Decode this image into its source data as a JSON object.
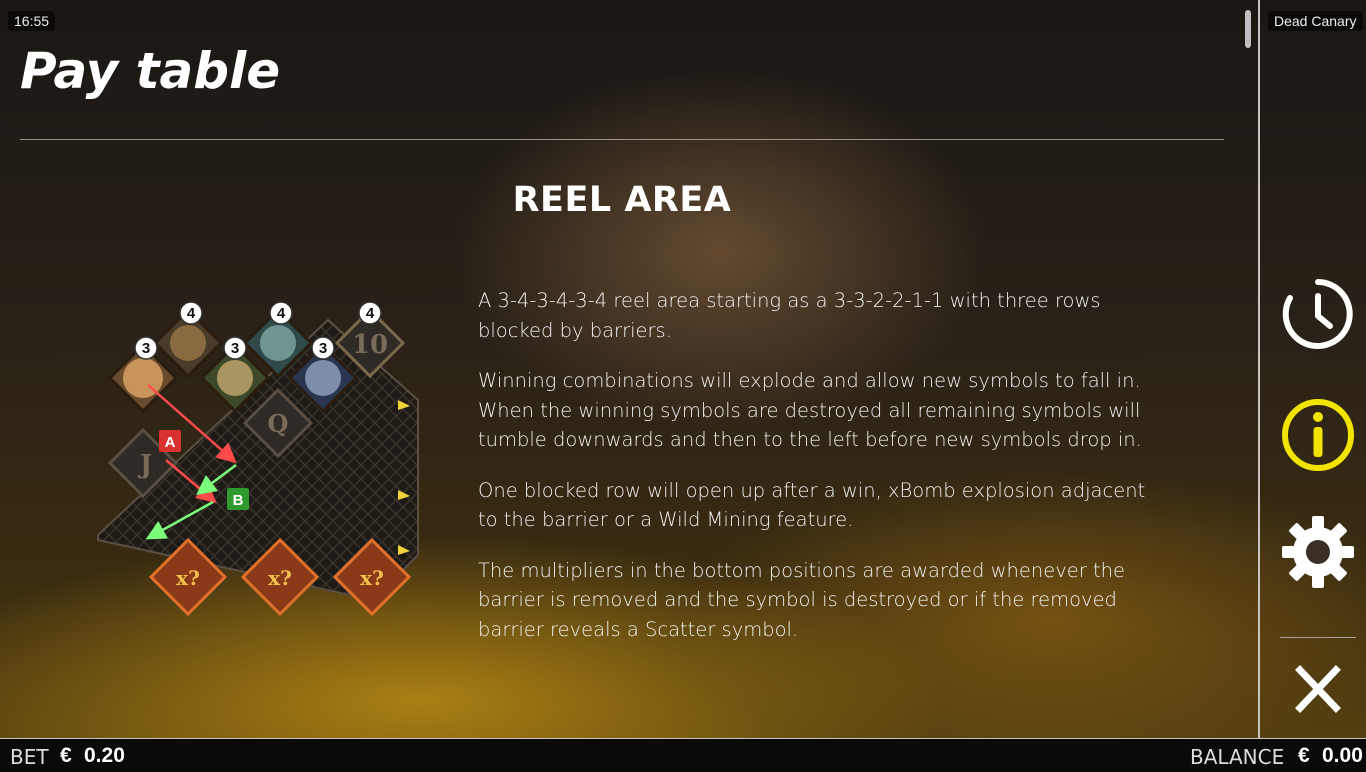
{
  "status": {
    "time": "16:55",
    "game_name": "Dead Canary"
  },
  "header": {
    "title": "Pay table"
  },
  "section": {
    "title": "REEL AREA",
    "paragraphs": [
      "A 3-4-3-4-3-4 reel area starting as a 3-3-2-2-1-1 with three rows blocked by barriers.",
      "Winning combinations will explode and allow new symbols to fall in. When the winning symbols are destroyed all remaining symbols will tumble downwards and then to the left before new symbols drop in.",
      "One blocked row will open up after a win, xBomb explosion adjacent to the barrier or a Wild Mining feature.",
      "The multipliers in the bottom positions are awarded whenever the barrier is removed and the symbol is destroyed or if the removed barrier reveals a Scatter symbol."
    ]
  },
  "diagram": {
    "reel_counts": [
      "3",
      "4",
      "3",
      "4",
      "3",
      "4"
    ],
    "symbols": [
      "10",
      "Q",
      "J"
    ],
    "marker_a": "A",
    "marker_b": "B",
    "multiplier_label": "x?"
  },
  "sidebar": {
    "history_icon": "clock-history-icon",
    "info_icon": "info-icon",
    "settings_icon": "gear-icon",
    "close_icon": "close-icon"
  },
  "footer": {
    "bet_label": "BET",
    "bet_currency": "€",
    "bet_value": "0.20",
    "balance_label": "BALANCE",
    "balance_currency": "€",
    "balance_value": "0.00"
  },
  "colors": {
    "accent_info": "#f2e400",
    "marker_a": "#d93030",
    "marker_b": "#2e9a2e"
  }
}
